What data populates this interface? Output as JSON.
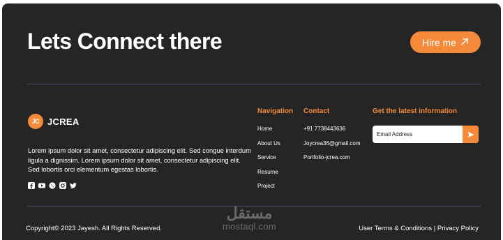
{
  "header": {
    "headline": "Lets Connect there",
    "hire_button_label": "Hire me"
  },
  "brand": {
    "logo_text": "JC",
    "name": "JCREA",
    "description": "Lorem ipsum dolor sit amet, consectetur adipiscing elit. Sed congue interdum ligula a dignissim. Lorem ipsum dolor sit amet, consectetur adipiscing elit. Sed lobortis orci elementum egestas lobortis."
  },
  "socials": [
    "facebook-icon",
    "youtube-icon",
    "whatsapp-icon",
    "instagram-icon",
    "twitter-icon"
  ],
  "navigation": {
    "title": "Navigation",
    "items": [
      "Home",
      "About Us",
      "Service",
      "Resume",
      "Project"
    ]
  },
  "contact": {
    "title": "Contact",
    "items": [
      "+91 7738443636",
      "Joycrea36@gmail.com",
      "Portfolio-jcrea.com"
    ]
  },
  "newsletter": {
    "title": "Get the latest information",
    "placeholder": "Email Address"
  },
  "footer": {
    "copyright": "Copyright© 2023 Jayesh. All Rights Reserved.",
    "terms_label": "User Terms & Conditions",
    "separator": "|",
    "privacy_label": "Privacy Policy"
  },
  "watermark": {
    "arabic": "مستقل",
    "latin": "mostaql.com"
  },
  "colors": {
    "background": "#252525",
    "accent": "#f58a3a",
    "divider": "#4a4a63"
  }
}
